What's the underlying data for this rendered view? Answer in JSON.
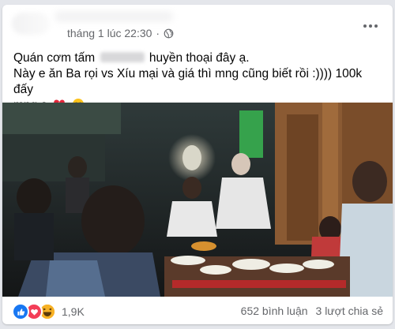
{
  "post": {
    "timestamp": "tháng 1 lúc 22:30",
    "separator": "·",
    "privacy_icon": "globe-icon",
    "text_line1_before": "Quán cơm tấm",
    "text_line1_after": "huyền thoại đây ạ.",
    "text_line2": "Này e ăn Ba rọi vs Xíu mại và giá thì mng cũng biết rồi :)))) 100k đấy",
    "text_line3": "mng ạ"
  },
  "reactions": {
    "icons": [
      "like-icon",
      "love-icon",
      "haha-icon"
    ],
    "count": "1,9K"
  },
  "stats": {
    "comments": "652 bình luận",
    "shares": "3 lượt chia sẻ"
  },
  "colors": {
    "like": "#1877f2",
    "love": "#f33e58",
    "haha": "#f7b125",
    "meta_text": "#65676b",
    "body_text": "#050505"
  }
}
